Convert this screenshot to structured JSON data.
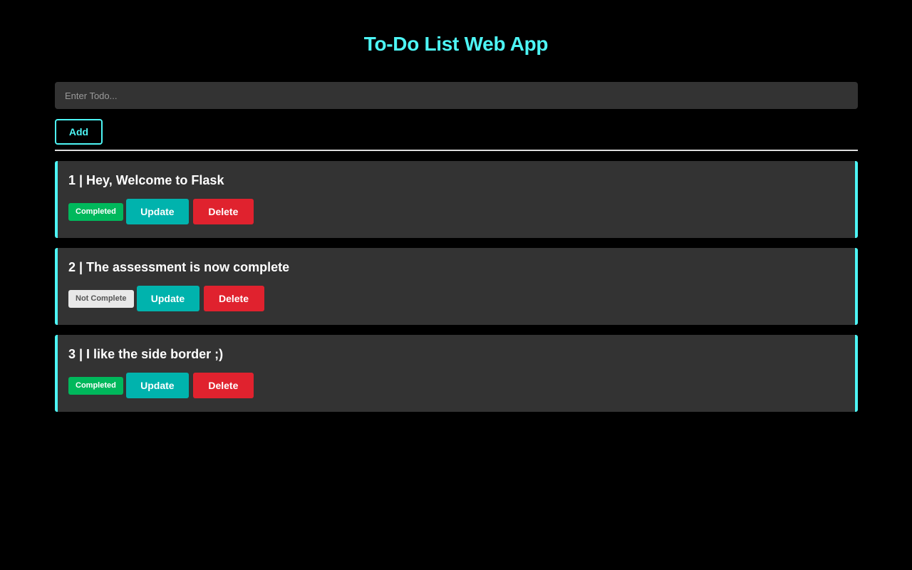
{
  "header": {
    "title": "To-Do List Web App"
  },
  "form": {
    "placeholder": "Enter Todo...",
    "value": "",
    "add_label": "Add"
  },
  "todos": [
    {
      "title": "1 | Hey, Welcome to Flask",
      "status": "Completed",
      "completed": true,
      "update_label": "Update",
      "delete_label": "Delete"
    },
    {
      "title": "2 | The assessment is now complete",
      "status": "Not Complete",
      "completed": false,
      "update_label": "Update",
      "delete_label": "Delete"
    },
    {
      "title": "3 | I like the side border ;)",
      "status": "Completed",
      "completed": true,
      "update_label": "Update",
      "delete_label": "Delete"
    }
  ],
  "colors": {
    "accent": "#4df5f5",
    "completed": "#00b85c",
    "update": "#00b3ad",
    "delete": "#e0222e",
    "card": "#333333"
  }
}
